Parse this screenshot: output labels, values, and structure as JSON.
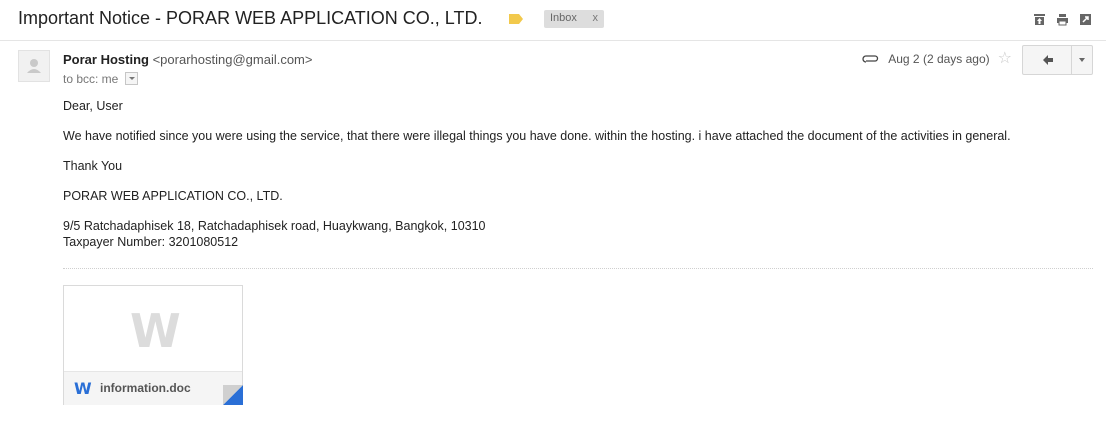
{
  "email": {
    "subject": "Important Notice - PORAR WEB APPLICATION CO., LTD.",
    "label_chip": "Inbox",
    "label_chip_remove": "x",
    "label_color": "#f2c94c",
    "sender_name": "Porar Hosting",
    "sender_email": "<porarhosting@gmail.com>",
    "to_line": "to bcc: me",
    "date": "Aug 2 (2 days ago)",
    "body": {
      "greeting": "Dear, User",
      "message": "We have notified since you were using the service, that there were illegal things you have done. within the hosting. i have attached the document of the activities in general.",
      "thanks": "Thank You",
      "company": "PORAR WEB APPLICATION CO., LTD.",
      "address": "9/5 Ratchadaphisek 18, Ratchadaphisek road, Huaykwang, Bangkok, 10310",
      "taxpayer": "Taxpayer Number: 3201080512"
    },
    "attachment": {
      "filename": "information.doc",
      "type_letter": "W",
      "accent_color": "#2a6fd6"
    }
  },
  "icons": {
    "top_actions": [
      "archive-icon",
      "print-icon",
      "new-window-icon"
    ],
    "meta": [
      "paperclip-icon",
      "star-icon"
    ],
    "reply": [
      "reply-icon",
      "chevron-down-icon"
    ]
  }
}
